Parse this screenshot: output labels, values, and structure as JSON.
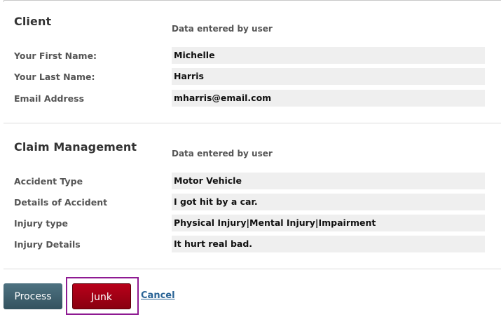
{
  "client": {
    "title": "Client",
    "note": "Data entered by user",
    "rows": [
      {
        "label": "Your First Name:",
        "value": "Michelle"
      },
      {
        "label": "Your Last Name:",
        "value": "Harris"
      },
      {
        "label": "Email Address",
        "value": "mharris@email.com"
      }
    ]
  },
  "claim": {
    "title": "Claim Management",
    "note": "Data entered by user",
    "rows": [
      {
        "label": "Accident Type",
        "value": "Motor Vehicle"
      },
      {
        "label": "Details of Accident",
        "value": "I got hit by a car."
      },
      {
        "label": "Injury type",
        "value": "Physical Injury|Mental Injury|Impairment"
      },
      {
        "label": "Injury Details",
        "value": "It hurt real bad."
      }
    ]
  },
  "actions": {
    "process_label": "Process",
    "junk_label": "Junk",
    "cancel_label": "Cancel"
  },
  "colors": {
    "process": "#3f6270",
    "junk": "#a30016",
    "highlight_frame": "#8e1a92",
    "link": "#2a6496"
  }
}
